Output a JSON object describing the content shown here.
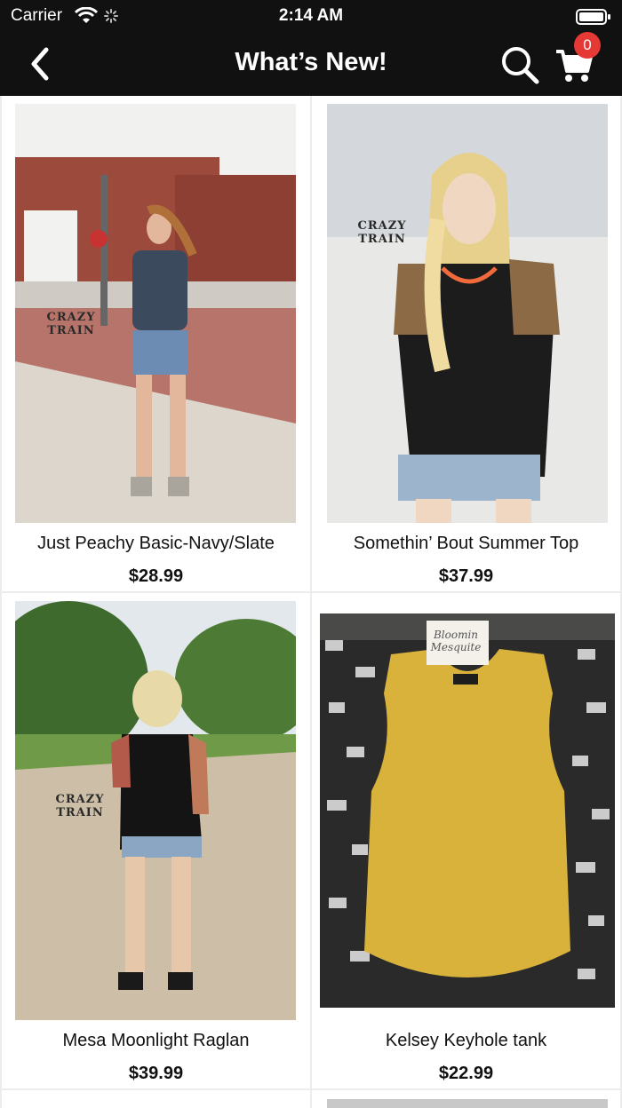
{
  "status": {
    "carrier": "Carrier",
    "time": "2:14 AM"
  },
  "header": {
    "title": "What’s New!",
    "cart_count": "0"
  },
  "products": [
    {
      "name": "Just Peachy Basic-Navy/Slate",
      "price": "$28.99",
      "watermark": "CRAZY TRAIN"
    },
    {
      "name": "Somethin’ Bout Summer Top",
      "price": "$37.99",
      "watermark": "CRAZY TRAIN"
    },
    {
      "name": "Mesa Moonlight Raglan",
      "price": "$39.99",
      "watermark": "CRAZY TRAIN"
    },
    {
      "name": "Kelsey Keyhole tank",
      "price": "$22.99",
      "watermark": "Bloomin Mesquite"
    }
  ],
  "icons": {
    "back": "chevron-left-icon",
    "search": "search-icon",
    "cart": "cart-icon"
  },
  "colors": {
    "bar": "#111111",
    "badge": "#e53935",
    "tank": "#d9b23c"
  }
}
